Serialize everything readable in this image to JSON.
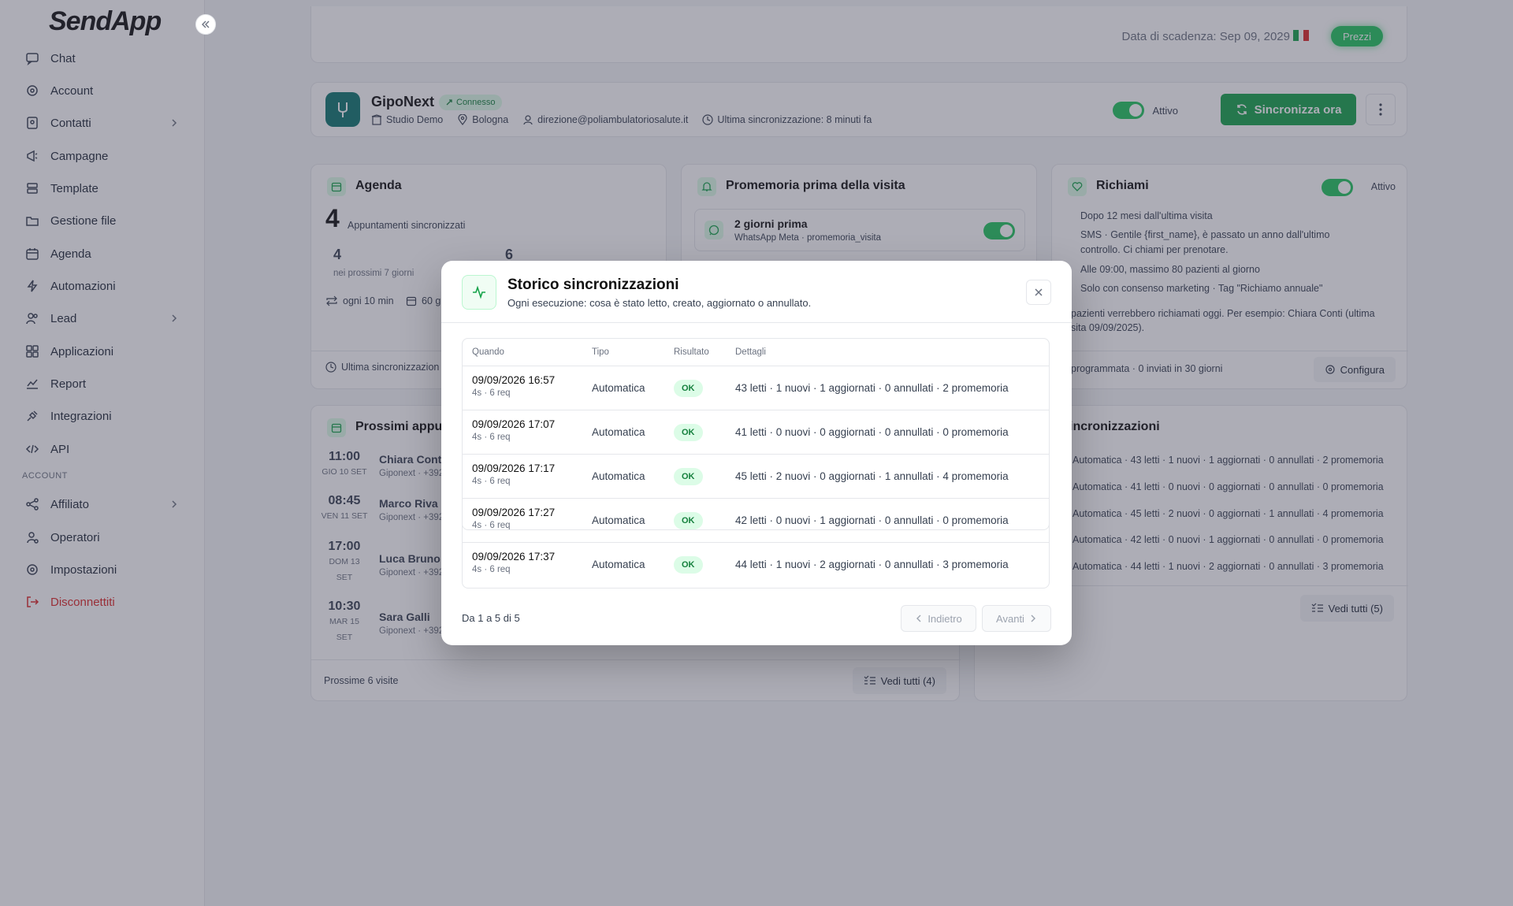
{
  "app": {
    "logo": "SendApp"
  },
  "sidebar": {
    "items": [
      {
        "label": "Chat",
        "icon": "chat-icon"
      },
      {
        "label": "Account",
        "icon": "gear-icon"
      },
      {
        "label": "Contatti",
        "icon": "contacts-icon"
      },
      {
        "label": "Campagne",
        "icon": "megaphone-icon"
      },
      {
        "label": "Template",
        "icon": "template-icon"
      },
      {
        "label": "Gestione file",
        "icon": "folder-icon"
      },
      {
        "label": "Agenda",
        "icon": "calendar-icon"
      },
      {
        "label": "Automazioni",
        "icon": "bolt-icon"
      },
      {
        "label": "Lead",
        "icon": "users-icon"
      },
      {
        "label": "Applicazioni",
        "icon": "apps-icon"
      },
      {
        "label": "Report",
        "icon": "chart-icon"
      },
      {
        "label": "Integrazioni",
        "icon": "plug-icon"
      },
      {
        "label": "API",
        "icon": "code-icon"
      }
    ],
    "section_label": "ACCOUNT",
    "account_items": [
      {
        "label": "Affiliato",
        "icon": "share-icon"
      },
      {
        "label": "Operatori",
        "icon": "user-gear-icon"
      },
      {
        "label": "Impostazioni",
        "icon": "gear-icon"
      },
      {
        "label": "Disconnettiti",
        "icon": "logout-icon"
      }
    ]
  },
  "topbar": {
    "expiry": "Data di scadenza: Sep 09, 2029",
    "price_button": "Prezzi"
  },
  "integration": {
    "name": "GipoNext",
    "status": "Connesso",
    "studio": "Studio Demo",
    "city": "Bologna",
    "email": "direzione@poliambulatoriosalute.it",
    "last_sync": "Ultima sincronizzazione: 8 minuti fa",
    "active_label": "Attivo",
    "sync_button": "Sincronizza ora"
  },
  "agenda": {
    "title": "Agenda",
    "big_count": "4",
    "big_label": "Appuntamenti sincronizzati",
    "stat1_value": "4",
    "stat1_label": "nei prossimi 7 giorni",
    "stat2_value": "6",
    "freq": "ogni 10 min",
    "window": "60 g",
    "footer": "Ultima sincronizzazion"
  },
  "reminder": {
    "title": "Promemoria prima della visita",
    "item_title": "2 giorni prima",
    "item_sub": "WhatsApp Meta · promemoria_visita"
  },
  "recall": {
    "title": "Richiami",
    "active_label": "Attivo",
    "line1": "Dopo 12 mesi dall'ultima visita",
    "line2a": "SMS · Gentile {first_name}, è passato un anno dall'ultimo",
    "line2b": "controllo. Ci chiami per prenotare.",
    "line3": "Alle 09:00, massimo 80 pazienti al giorno",
    "line4": "Solo con consenso marketing · Tag \"Richiamo annuale\"",
    "note_a": "pazienti verrebbero richiamati oggi. Per esempio: Chiara Conti (ultima",
    "note_b": "sita 09/09/2025).",
    "footer": "programmata · 0 inviati in 30 giorni",
    "configure": "Configura"
  },
  "appointments": {
    "title": "Prossimi appun",
    "rows": [
      {
        "time": "11:00",
        "date": "GIO 10 SET",
        "name": "Chiara Conti",
        "sub": "Giponext · +392"
      },
      {
        "time": "08:45",
        "date": "VEN 11 SET",
        "name": "Marco Riva",
        "sub": "Giponext · +392"
      },
      {
        "time": "17:00",
        "date": "DOM 13",
        "date2": "SET",
        "name": "Luca Bruno",
        "sub": "Giponext · +392"
      },
      {
        "time": "10:30",
        "date": "MAR 15",
        "date2": "SET",
        "name": "Sara Galli",
        "sub": "Giponext · +392"
      }
    ],
    "footer": "Prossime 6 visite",
    "see_all": "Vedi tutti (4)"
  },
  "sync_card": {
    "title": "incronizzazioni",
    "rows": [
      "Automatica · 43 letti · 1 nuovi · 1 aggiornati · 0 annullati · 2 promemoria",
      "Automatica · 41 letti · 0 nuovi · 0 aggiornati · 0 annullati · 0 promemoria",
      "Automatica · 45 letti · 2 nuovi · 0 aggiornati · 1 annullati · 4 promemoria",
      "Automatica · 42 letti · 0 nuovi · 1 aggiornati · 0 annullati · 0 promemoria",
      "Automatica · 44 letti · 1 nuovi · 2 aggiornati · 0 annullati · 3 promemoria"
    ],
    "left_footer": "i",
    "see_all": "Vedi tutti (5)"
  },
  "modal": {
    "title": "Storico sincronizzazioni",
    "subtitle": "Ogni esecuzione: cosa è stato letto, creato, aggiornato o annullato.",
    "headers": {
      "when": "Quando",
      "type": "Tipo",
      "result": "Risultato",
      "details": "Dettagli"
    },
    "rows": [
      {
        "when": "09/09/2026 16:57",
        "meta": "4s · 6 req",
        "type": "Automatica",
        "result": "OK",
        "details": "43 letti · 1 nuovi · 1 aggiornati · 0 annullati · 2 promemoria"
      },
      {
        "when": "09/09/2026 17:07",
        "meta": "4s · 6 req",
        "type": "Automatica",
        "result": "OK",
        "details": "41 letti · 0 nuovi · 0 aggiornati · 0 annullati · 0 promemoria"
      },
      {
        "when": "09/09/2026 17:17",
        "meta": "4s · 6 req",
        "type": "Automatica",
        "result": "OK",
        "details": "45 letti · 2 nuovi · 0 aggiornati · 1 annullati · 4 promemoria"
      },
      {
        "when": "09/09/2026 17:27",
        "meta": "4s · 6 req",
        "type": "Automatica",
        "result": "OK",
        "details": "42 letti · 0 nuovi · 1 aggiornati · 0 annullati · 0 promemoria"
      },
      {
        "when": "09/09/2026 17:37",
        "meta": "4s · 6 req",
        "type": "Automatica",
        "result": "OK",
        "details": "44 letti · 1 nuovi · 2 aggiornati · 0 annullati · 3 promemoria"
      }
    ],
    "pagination": "Da 1 a 5 di 5",
    "prev": "Indietro",
    "next": "Avanti"
  },
  "colors": {
    "accent": "#16a34a",
    "danger": "#dc2626",
    "overlay": "rgba(60,60,80,0.42)"
  }
}
